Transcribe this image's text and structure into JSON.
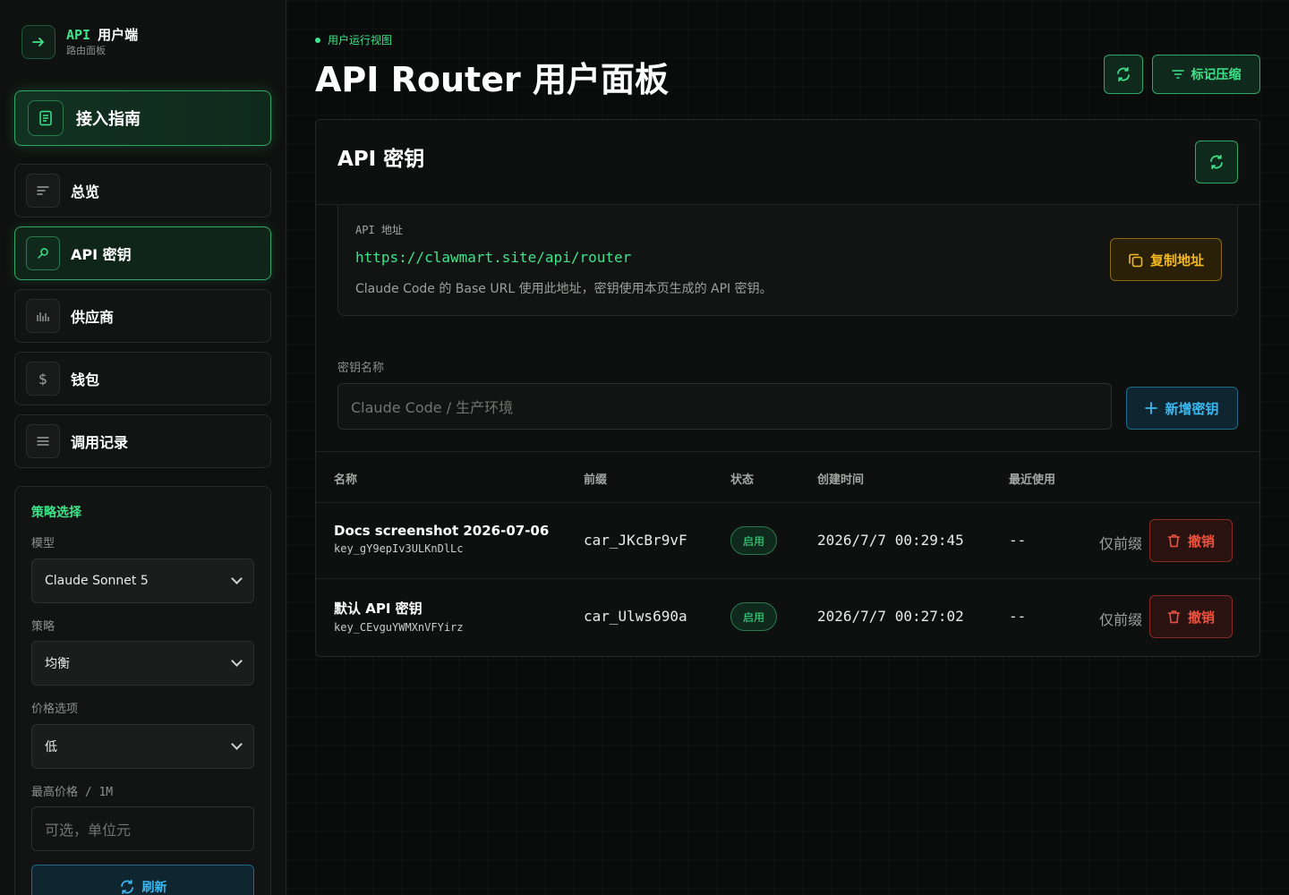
{
  "brand": {
    "accent": "API",
    "title": "用户端",
    "subtitle": "路由面板"
  },
  "sidebar": {
    "guide_label": "接入指南",
    "items": [
      {
        "label": "总览",
        "icon": "lines-icon"
      },
      {
        "label": "API 密钥",
        "icon": "key-icon"
      },
      {
        "label": "供应商",
        "icon": "bars-icon"
      },
      {
        "label": "钱包",
        "icon": "dollar-icon"
      },
      {
        "label": "调用记录",
        "icon": "list-icon"
      }
    ]
  },
  "strategy": {
    "title": "策略选择",
    "model_label": "模型",
    "model_value": "Claude Sonnet 5",
    "strategy_label": "策略",
    "strategy_value": "均衡",
    "price_label": "价格选项",
    "price_value": "低",
    "max_price_label": "最高价格 / 1M",
    "max_price_placeholder": "可选，单位元",
    "refresh_label": "刷新"
  },
  "header": {
    "eyebrow": "用户运行视图",
    "title": "API Router 用户面板",
    "mark_label": "标记压缩"
  },
  "panel": {
    "title": "API 密钥",
    "address_label": "API 地址",
    "address_url": "https://clawmart.site/api/router",
    "address_desc": "Claude Code 的 Base URL 使用此地址，密钥使用本页生成的 API 密钥。",
    "copy_label": "复制地址",
    "key_name_label": "密钥名称",
    "key_name_placeholder": "Claude Code / 生产环境",
    "add_label": "新增密钥"
  },
  "table": {
    "headers": [
      "名称",
      "前缀",
      "状态",
      "创建时间",
      "最近使用"
    ],
    "rows": [
      {
        "name": "Docs screenshot 2026-07-06",
        "key": "key_gY9epIv3ULKnDlLc",
        "prefix": "car_JKcBr9vF",
        "status": "启用",
        "created": "2026/7/7 00:29:45",
        "last_used": "--",
        "scope": "仅前缀",
        "action": "撤销"
      },
      {
        "name": "默认 API 密钥",
        "key": "key_CEvguYWMXnVFYirz",
        "prefix": "car_Ulws690a",
        "status": "启用",
        "created": "2026/7/7 00:27:02",
        "last_used": "--",
        "scope": "仅前缀",
        "action": "撤销"
      }
    ]
  },
  "colors": {
    "accent_green": "#3ee38a",
    "accent_blue": "#3bb8f0",
    "accent_amber": "#f2b824",
    "danger": "#f0503c",
    "background": "#0a0b0b"
  }
}
